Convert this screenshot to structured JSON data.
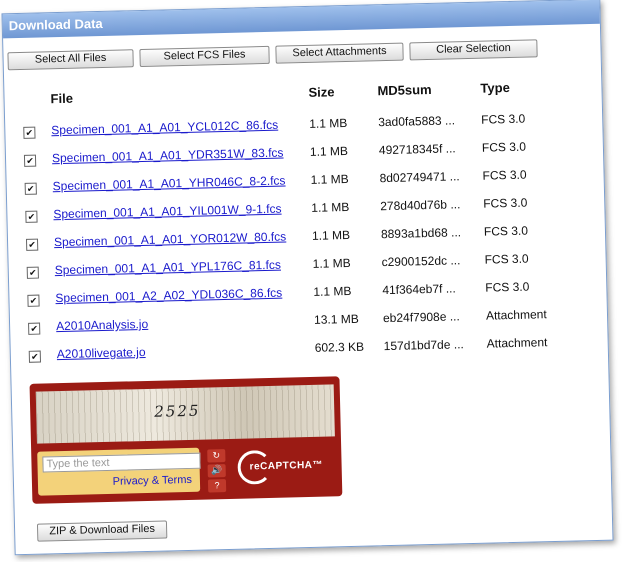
{
  "window": {
    "title": "Download Data"
  },
  "toolbar": {
    "select_all": "Select All Files",
    "select_fcs": "Select FCS Files",
    "select_attachments": "Select Attachments",
    "clear_selection": "Clear Selection"
  },
  "table": {
    "headers": {
      "file": "File",
      "size": "Size",
      "md5": "MD5sum",
      "type": "Type"
    },
    "rows": [
      {
        "checked": "✔",
        "file": "Specimen_001_A1_A01_YCL012C_86.fcs",
        "size": "1.1 MB",
        "md5": "3ad0fa5883 ...",
        "type": "FCS 3.0"
      },
      {
        "checked": "✔",
        "file": "Specimen_001_A1_A01_YDR351W_83.fcs",
        "size": "1.1 MB",
        "md5": "492718345f ...",
        "type": "FCS 3.0"
      },
      {
        "checked": "✔",
        "file": "Specimen_001_A1_A01_YHR046C_8-2.fcs",
        "size": "1.1 MB",
        "md5": "8d02749471 ...",
        "type": "FCS 3.0"
      },
      {
        "checked": "✔",
        "file": "Specimen_001_A1_A01_YIL001W_9-1.fcs",
        "size": "1.1 MB",
        "md5": "278d40d76b ...",
        "type": "FCS 3.0"
      },
      {
        "checked": "✔",
        "file": "Specimen_001_A1_A01_YOR012W_80.fcs",
        "size": "1.1 MB",
        "md5": "8893a1bd68 ...",
        "type": "FCS 3.0"
      },
      {
        "checked": "✔",
        "file": "Specimen_001_A1_A01_YPL176C_81.fcs",
        "size": "1.1 MB",
        "md5": "c2900152dc ...",
        "type": "FCS 3.0"
      },
      {
        "checked": "✔",
        "file": "Specimen_001_A2_A02_YDL036C_86.fcs",
        "size": "1.1 MB",
        "md5": "41f364eb7f ...",
        "type": "FCS 3.0"
      },
      {
        "checked": "✔",
        "file": "A2010Analysis.jo",
        "size": "13.1 MB",
        "md5": "eb24f7908e ...",
        "type": "Attachment"
      },
      {
        "checked": "✔",
        "file": "A2010livegate.jo",
        "size": "602.3 KB",
        "md5": "157d1bd7de ...",
        "type": "Attachment"
      }
    ]
  },
  "captcha": {
    "challenge_text": "2525",
    "placeholder": "Type the text",
    "privacy_link": "Privacy & Terms",
    "refresh_icon": "↻",
    "audio_icon": "🔊",
    "help_icon": "?",
    "logo_text": "reCAPTCHA™"
  },
  "footer": {
    "zip_button": "ZIP & Download Files"
  },
  "colors": {
    "titlebar": "#7fa4dc",
    "link": "#1a1acc",
    "captcha_bg": "#9b1b14"
  }
}
